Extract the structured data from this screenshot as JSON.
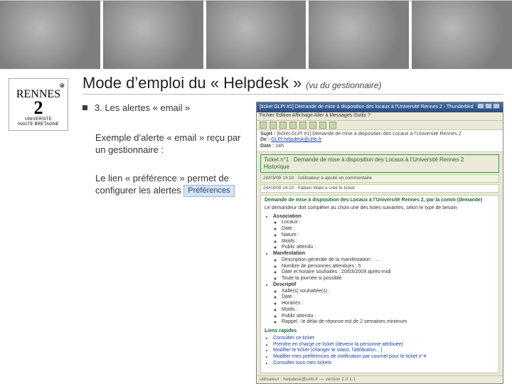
{
  "banner": {
    "tiles": 5
  },
  "logo": {
    "top_small": "⊕",
    "line1": "RENNES",
    "line2": "2",
    "line3": "UNIVERSITE",
    "line4": "HAUTE BRETAGNE"
  },
  "title_main": "Mode d’emploi du « Helpdesk » ",
  "title_sub": "(vu du gestionnaire)",
  "section_title": "3. Les alertes « email »",
  "para1": "Exemple d’alerte « email » reçu par un gestionnaire :",
  "para2_a": "Le lien « préférence » permet de configurer les alertes",
  "pref_label": "Préférences",
  "mail": {
    "window_title": "[ticket GLPI #1] Demande de mise à disposition des locaux à l’Université Rennes 2 - Thunderbird",
    "menu": "Fichier  Édition  Affichage  Aller à  Messages  Outils  ?",
    "header_subject_label": "Sujet :",
    "header_subject": "[ticket GLPI #1] Demande de mise à disposition des Locaux à l’Université Rennes 2",
    "header_from_label": "De :",
    "header_from": "GLPI helpdesk@uhb.fr",
    "header_date_label": "Date :",
    "header_date": "14h",
    "obj_title": "Ticket n°1 : Demande de mise à disposition des Locaux à l’Université Rennes 2",
    "obj_sub": "Historique",
    "tstamp1": "24/03/09 14:10 : l’utilisateur a ajouté un commentaire",
    "tstamp2": "24/03/09 14:10 : Fabien Wald a créé le ticket",
    "body_heading": "Demande de mise à disposition des Locaux à l’Université Rennes 2, par la comm (demande)",
    "body_intro": "Le demandeur doit compléter au choix une des listes suivantes, selon le type de besoin",
    "assoc_label": "Association",
    "assoc_items": [
      "Locaux :",
      "Date :",
      "Nature :",
      "Motifs :",
      "Public attendu :"
    ],
    "manif_label": "Manifestation",
    "manif_items": [
      "Description générale de la manifestation : …",
      "Nombre de personnes attendues : 5",
      "Date et horaire souhaités : 20/03/2009 après-midi",
      "Toute la journée si possible"
    ],
    "desc_label": "Descriptif",
    "desc_items": [
      "Salle(s) souhaitée(s) :",
      "Date :",
      "Horaires :",
      "Motifs :",
      "Public attendu :",
      "Rappel : le délai de réponse est de 2 semaines minimum"
    ],
    "quick_title": "Liens rapides",
    "quick_items": [
      "Consulter ce ticket",
      "Prendre en charge ce ticket (devenir la personne attribuée)",
      "Modifier le ticket (changer le statut, l’attribution…)",
      "Modifier mes préférences de notification par courriel pour le ticket n°4",
      "Consulter tous mes tickets"
    ],
    "footer": "utilisateur : helpdesk@uhb.fr — version 2.0.1.1"
  }
}
